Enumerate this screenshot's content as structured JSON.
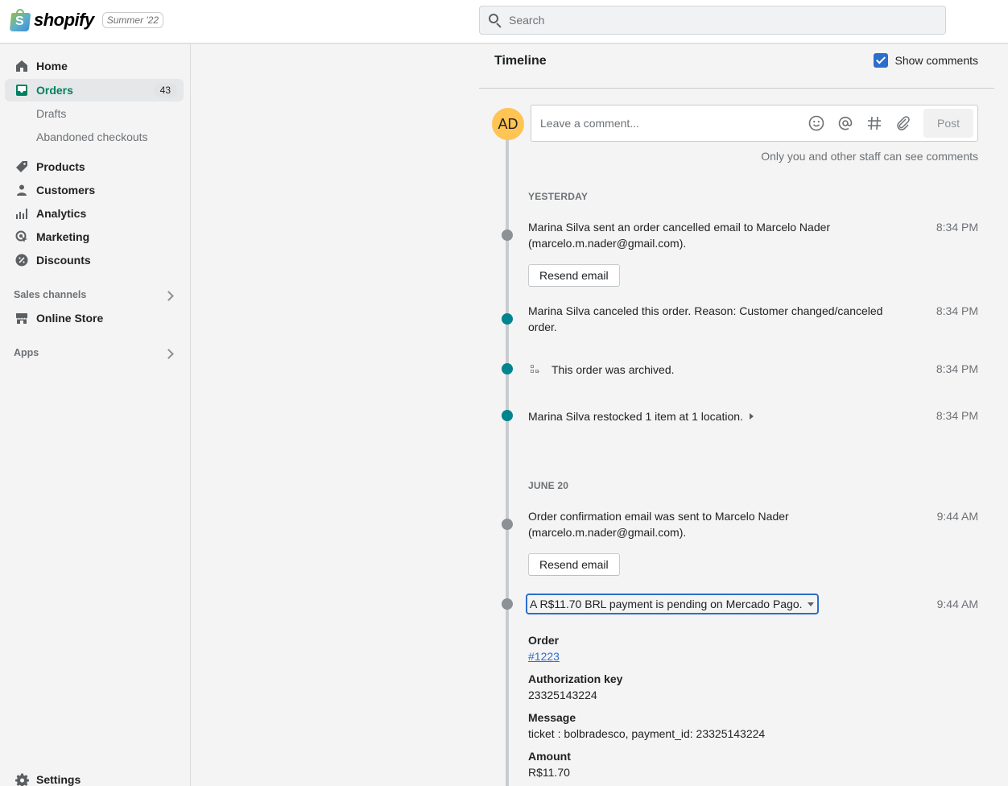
{
  "topbar": {
    "brand": "shopify",
    "edition_badge": "Summer '22",
    "search_placeholder": "Search"
  },
  "sidebar": {
    "items": [
      {
        "label": "Home",
        "icon": "home-icon"
      },
      {
        "label": "Orders",
        "icon": "orders-icon",
        "badge": "43",
        "active": true,
        "subitems": [
          {
            "label": "Drafts"
          },
          {
            "label": "Abandoned checkouts"
          }
        ]
      },
      {
        "label": "Products",
        "icon": "tag-icon"
      },
      {
        "label": "Customers",
        "icon": "person-icon"
      },
      {
        "label": "Analytics",
        "icon": "bar-chart-icon"
      },
      {
        "label": "Marketing",
        "icon": "target-icon"
      },
      {
        "label": "Discounts",
        "icon": "discount-icon"
      }
    ],
    "sales_channels": {
      "label": "Sales channels",
      "items": [
        {
          "label": "Online Store",
          "icon": "store-icon"
        }
      ]
    },
    "apps": {
      "label": "Apps"
    },
    "settings": {
      "label": "Settings",
      "icon": "gear-icon"
    }
  },
  "timeline": {
    "title": "Timeline",
    "show_comments": {
      "label": "Show comments",
      "checked": true
    },
    "avatar_initials": "AD",
    "comment_placeholder": "Leave a comment...",
    "comment_tools": [
      "emoji-icon",
      "mention-icon",
      "hashtag-icon",
      "attachment-icon"
    ],
    "post_label": "Post",
    "comment_note": "Only you and other staff can see comments",
    "groups": [
      {
        "day": "YESTERDAY",
        "events": [
          {
            "text": "Marina Silva sent an order cancelled email to Marcelo Nader (marcelo.m.nader@gmail.com).",
            "time": "8:34 PM",
            "dot": "gray",
            "action": "Resend email"
          },
          {
            "text": "Marina Silva canceled this order. Reason: Customer changed/canceled order.",
            "time": "8:34 PM",
            "dot": "teal"
          },
          {
            "text": "This order was archived.",
            "time": "8:34 PM",
            "dot": "teal",
            "icon": "archive-icon"
          },
          {
            "text": "Marina Silva restocked 1 item at 1 location.",
            "time": "8:34 PM",
            "dot": "teal",
            "expandable": true
          }
        ]
      },
      {
        "day": "JUNE 20",
        "events": [
          {
            "text": "Order confirmation email was sent to Marcelo Nader (marcelo.m.nader@gmail.com).",
            "time": "9:44 AM",
            "dot": "gray",
            "action": "Resend email"
          },
          {
            "text": "A R$11.70 BRL payment is pending on Mercado Pago.",
            "time": "9:44 AM",
            "dot": "gray",
            "expanded": true,
            "details": [
              {
                "label": "Order",
                "value": "#1223",
                "link": true
              },
              {
                "label": "Authorization key",
                "value": "23325143224"
              },
              {
                "label": "Message",
                "value": "ticket : bolbradesco, payment_id: 23325143224"
              },
              {
                "label": "Amount",
                "value": "R$11.70"
              }
            ]
          }
        ]
      }
    ]
  },
  "colors": {
    "accent_green": "#008060",
    "checkbox_blue": "#2c6ecb",
    "dot_teal": "#00848e",
    "dot_gray": "#8c9196",
    "avatar_yellow": "#ffc453"
  }
}
